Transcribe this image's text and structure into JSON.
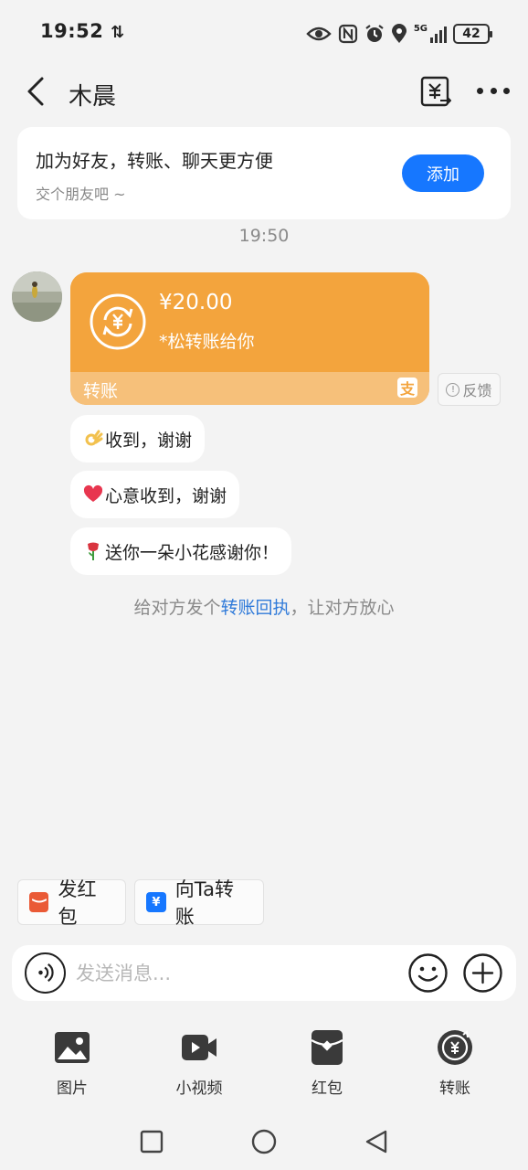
{
  "status_bar": {
    "time": "19:52",
    "data_arrows": "⇅",
    "network": "5G",
    "battery": "42"
  },
  "header": {
    "title": "木晨"
  },
  "banner": {
    "title": "加为好友，转账、聊天更方便",
    "subtitle": "交个朋友吧 ~",
    "add_button": "添加"
  },
  "time_separator": "19:50",
  "transfer_card": {
    "amount": "¥20.00",
    "description": "*松转账给你",
    "label": "转账",
    "brand_glyph": "支"
  },
  "feedback_label": "反馈",
  "replies": [
    {
      "emoji": "ok-hand-emoji",
      "text": "收到，谢谢"
    },
    {
      "emoji": "heart-emoji",
      "text": "心意收到，谢谢"
    },
    {
      "emoji": "rose-emoji",
      "text": "送你一朵小花感谢你！"
    }
  ],
  "receipt_tip": {
    "before": "给对方发个",
    "link": "转账回执",
    "after": "，让对方放心"
  },
  "quick_actions": {
    "red_packet": "发红包",
    "transfer_to": "向Ta转账"
  },
  "input": {
    "placeholder": "发送消息..."
  },
  "tools": [
    {
      "icon": "image-icon",
      "label": "图片"
    },
    {
      "icon": "video-icon",
      "label": "小视频"
    },
    {
      "icon": "red-packet-icon",
      "label": "红包"
    },
    {
      "icon": "transfer-icon",
      "label": "转账"
    }
  ],
  "colors": {
    "accent_blue": "#1677ff",
    "transfer_orange": "#f3a43d",
    "link_blue": "#2f7ad9"
  }
}
